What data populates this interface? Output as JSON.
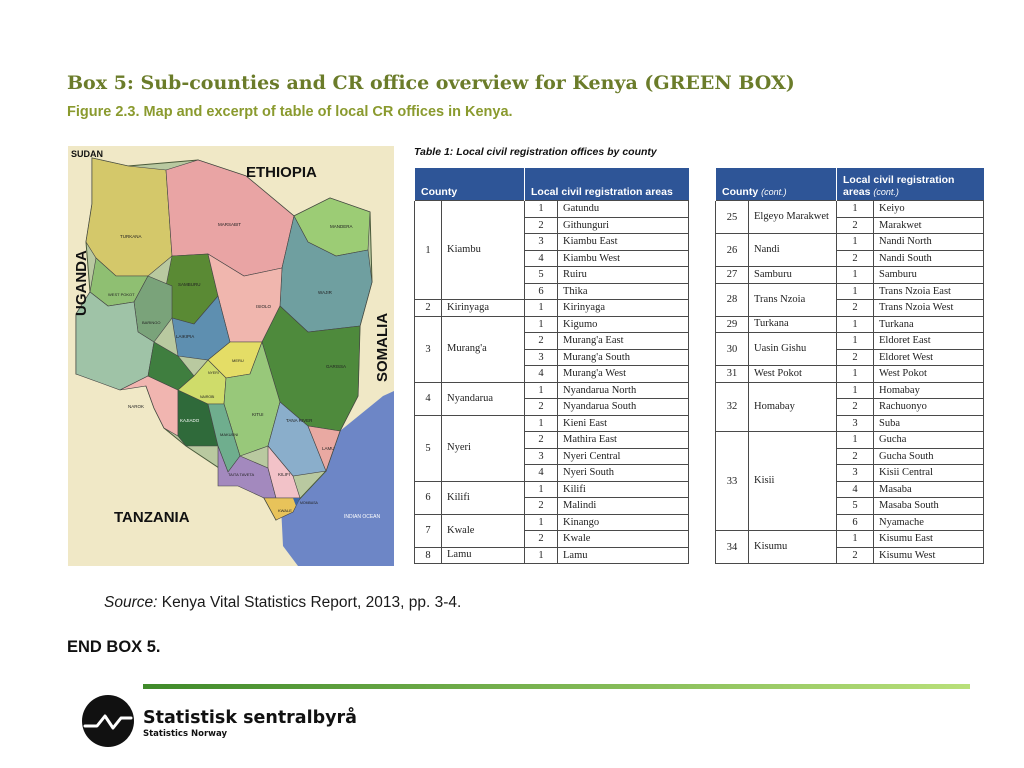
{
  "title": "Box 5: Sub-counties and CR office overview for Kenya (GREEN BOX)",
  "subtitle": "Figure 2.3. Map and excerpt of table of local CR offices in Kenya.",
  "map": {
    "labels": {
      "sudan": "SUDAN",
      "ethiopia": "ETHIOPIA",
      "uganda": "UGANDA",
      "somalia": "SOMALIA",
      "tanzania": "TANZANIA",
      "indian_ocean": "INDIAN OCEAN"
    },
    "county_labels": [
      "TURKANA",
      "MARSABIT",
      "MANDERA",
      "WAJIR",
      "WEST POKOT",
      "SAMBURU",
      "ISIOLO",
      "BARINGO",
      "LAIKIPIA",
      "GARISSA",
      "MERU",
      "NAROK",
      "KITUI",
      "TANA RIVER",
      "MAKUENI",
      "KAJIADO",
      "LAMU",
      "KILIFI",
      "TAITA TAVETA",
      "KWALE",
      "MOMBASA",
      "NYERI",
      "NAIROBI"
    ]
  },
  "table": {
    "caption": "Table 1: Local civil registration offices by county",
    "left": {
      "header_county": "County",
      "header_areas": "Local civil registration areas",
      "groups": [
        {
          "num": "1",
          "county": "Kiambu",
          "rows": [
            [
              "1",
              "Gatundu"
            ],
            [
              "2",
              "Githunguri"
            ],
            [
              "3",
              "Kiambu East"
            ],
            [
              "4",
              "Kiambu West"
            ],
            [
              "5",
              "Ruiru"
            ],
            [
              "6",
              "Thika"
            ]
          ]
        },
        {
          "num": "2",
          "county": "Kirinyaga",
          "rows": [
            [
              "1",
              "Kirinyaga"
            ]
          ]
        },
        {
          "num": "3",
          "county": "Murang'a",
          "rows": [
            [
              "1",
              "Kigumo"
            ],
            [
              "2",
              "Murang'a East"
            ],
            [
              "3",
              "Murang'a South"
            ],
            [
              "4",
              "Murang'a West"
            ]
          ]
        },
        {
          "num": "4",
          "county": "Nyandarua",
          "rows": [
            [
              "1",
              "Nyandarua North"
            ],
            [
              "2",
              "Nyandarua South"
            ]
          ]
        },
        {
          "num": "5",
          "county": "Nyeri",
          "rows": [
            [
              "1",
              "Kieni East"
            ],
            [
              "2",
              "Mathira East"
            ],
            [
              "3",
              "Nyeri Central"
            ],
            [
              "4",
              "Nyeri South"
            ]
          ]
        },
        {
          "num": "6",
          "county": "Kilifi",
          "rows": [
            [
              "1",
              "Kilifi"
            ],
            [
              "2",
              "Malindi"
            ]
          ]
        },
        {
          "num": "7",
          "county": "Kwale",
          "rows": [
            [
              "1",
              "Kinango"
            ],
            [
              "2",
              "Kwale"
            ]
          ]
        },
        {
          "num": "8",
          "county": "Lamu",
          "rows": [
            [
              "1",
              "Lamu"
            ]
          ]
        }
      ]
    },
    "right": {
      "header_county": "County",
      "header_county_cont": "(cont.)",
      "header_areas": "Local civil registration areas",
      "header_areas_cont": "(cont.)",
      "groups": [
        {
          "num": "25",
          "county": "Elgeyo Marakwet",
          "rows": [
            [
              "1",
              "Keiyo"
            ],
            [
              "2",
              "Marakwet"
            ]
          ]
        },
        {
          "num": "26",
          "county": "Nandi",
          "rows": [
            [
              "1",
              "Nandi North"
            ],
            [
              "2",
              "Nandi South"
            ]
          ]
        },
        {
          "num": "27",
          "county": "Samburu",
          "rows": [
            [
              "1",
              "Samburu"
            ]
          ]
        },
        {
          "num": "28",
          "county": "Trans Nzoia",
          "rows": [
            [
              "1",
              "Trans Nzoia East"
            ],
            [
              "2",
              "Trans Nzoia West"
            ]
          ]
        },
        {
          "num": "29",
          "county": "Turkana",
          "rows": [
            [
              "1",
              "Turkana"
            ]
          ]
        },
        {
          "num": "30",
          "county": "Uasin Gishu",
          "rows": [
            [
              "1",
              "Eldoret East"
            ],
            [
              "2",
              "Eldoret West"
            ]
          ]
        },
        {
          "num": "31",
          "county": "West Pokot",
          "rows": [
            [
              "1",
              "West Pokot"
            ]
          ]
        },
        {
          "num": "32",
          "county": "Homabay",
          "rows": [
            [
              "1",
              "Homabay"
            ],
            [
              "2",
              "Rachuonyo"
            ],
            [
              "3",
              "Suba"
            ]
          ]
        },
        {
          "num": "33",
          "county": "Kisii",
          "rows": [
            [
              "1",
              "Gucha"
            ],
            [
              "2",
              "Gucha South"
            ],
            [
              "3",
              "Kisii Central"
            ],
            [
              "4",
              "Masaba"
            ],
            [
              "5",
              "Masaba South"
            ],
            [
              "6",
              "Nyamache"
            ]
          ]
        },
        {
          "num": "34",
          "county": "Kisumu",
          "rows": [
            [
              "1",
              "Kisumu East"
            ],
            [
              "2",
              "Kisumu West"
            ]
          ]
        }
      ]
    }
  },
  "source": {
    "prefix": "Source:",
    "text": " Kenya Vital Statistics Report, 2013, pp. 3-4."
  },
  "end_box": "END BOX 5.",
  "footer": {
    "org_name": "Statistisk sentralbyrå",
    "org_sub": "Statistics Norway",
    "rule_colors": [
      "#3f8a2a",
      "#b9e07a"
    ]
  },
  "colors": {
    "title": "#6b7c2a",
    "subtitle": "#8a9a2e",
    "table_header": "#2e5597"
  }
}
